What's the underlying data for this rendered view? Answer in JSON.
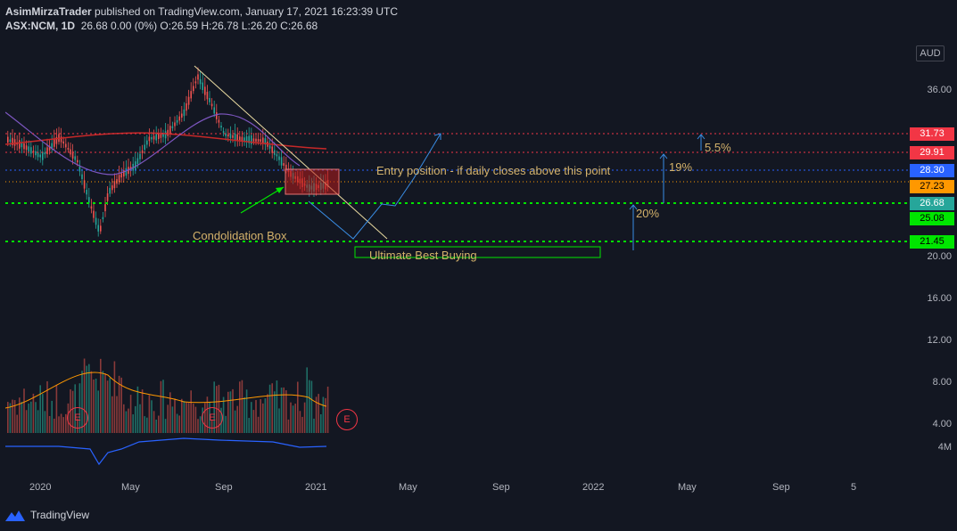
{
  "header": {
    "author": "AsimMirzaTrader",
    "published": " published on TradingView.com, January 17, 2021 16:23:39 UTC",
    "symbol": "ASX:NCM, 1D",
    "ohlc": "26.68 0.00 (0%) O:26.59 H:26.78 L:26.20 C:26.68"
  },
  "currency_button": "AUD",
  "price_axis": {
    "labels": [
      "36.00",
      "20.00",
      "16.00",
      "12.00",
      "8.00",
      "4.00",
      "4M"
    ],
    "tags": [
      {
        "value": "31.73",
        "color": "#f23645"
      },
      {
        "value": "29.91",
        "color": "#f23645"
      },
      {
        "value": "28.30",
        "color": "#2962ff"
      },
      {
        "value": "27.23",
        "color": "#ff9800"
      },
      {
        "value": "26.68",
        "color": "#26a69a"
      },
      {
        "value": "25.08",
        "color": "#00e600"
      },
      {
        "value": "21.45",
        "color": "#00e600"
      }
    ]
  },
  "time_axis": [
    "2020",
    "May",
    "Sep",
    "2021",
    "May",
    "Sep",
    "2022",
    "May",
    "Sep",
    "5"
  ],
  "annotations": {
    "entry": "Entry position - if daily closes above this point",
    "consolidation": "Condolidation Box",
    "ultimate": "Ultimate Best Buying",
    "pct_5_5": "5.5%",
    "pct_19": "19%",
    "pct_20": "20%"
  },
  "earnings_badge": "E",
  "footer": {
    "brand": "TradingView"
  },
  "colors": {
    "background": "#131722",
    "annotation": "#d4b26b",
    "green_level": "#00e600",
    "red_level": "#f23645",
    "arrow": "#3a8ee6"
  }
}
